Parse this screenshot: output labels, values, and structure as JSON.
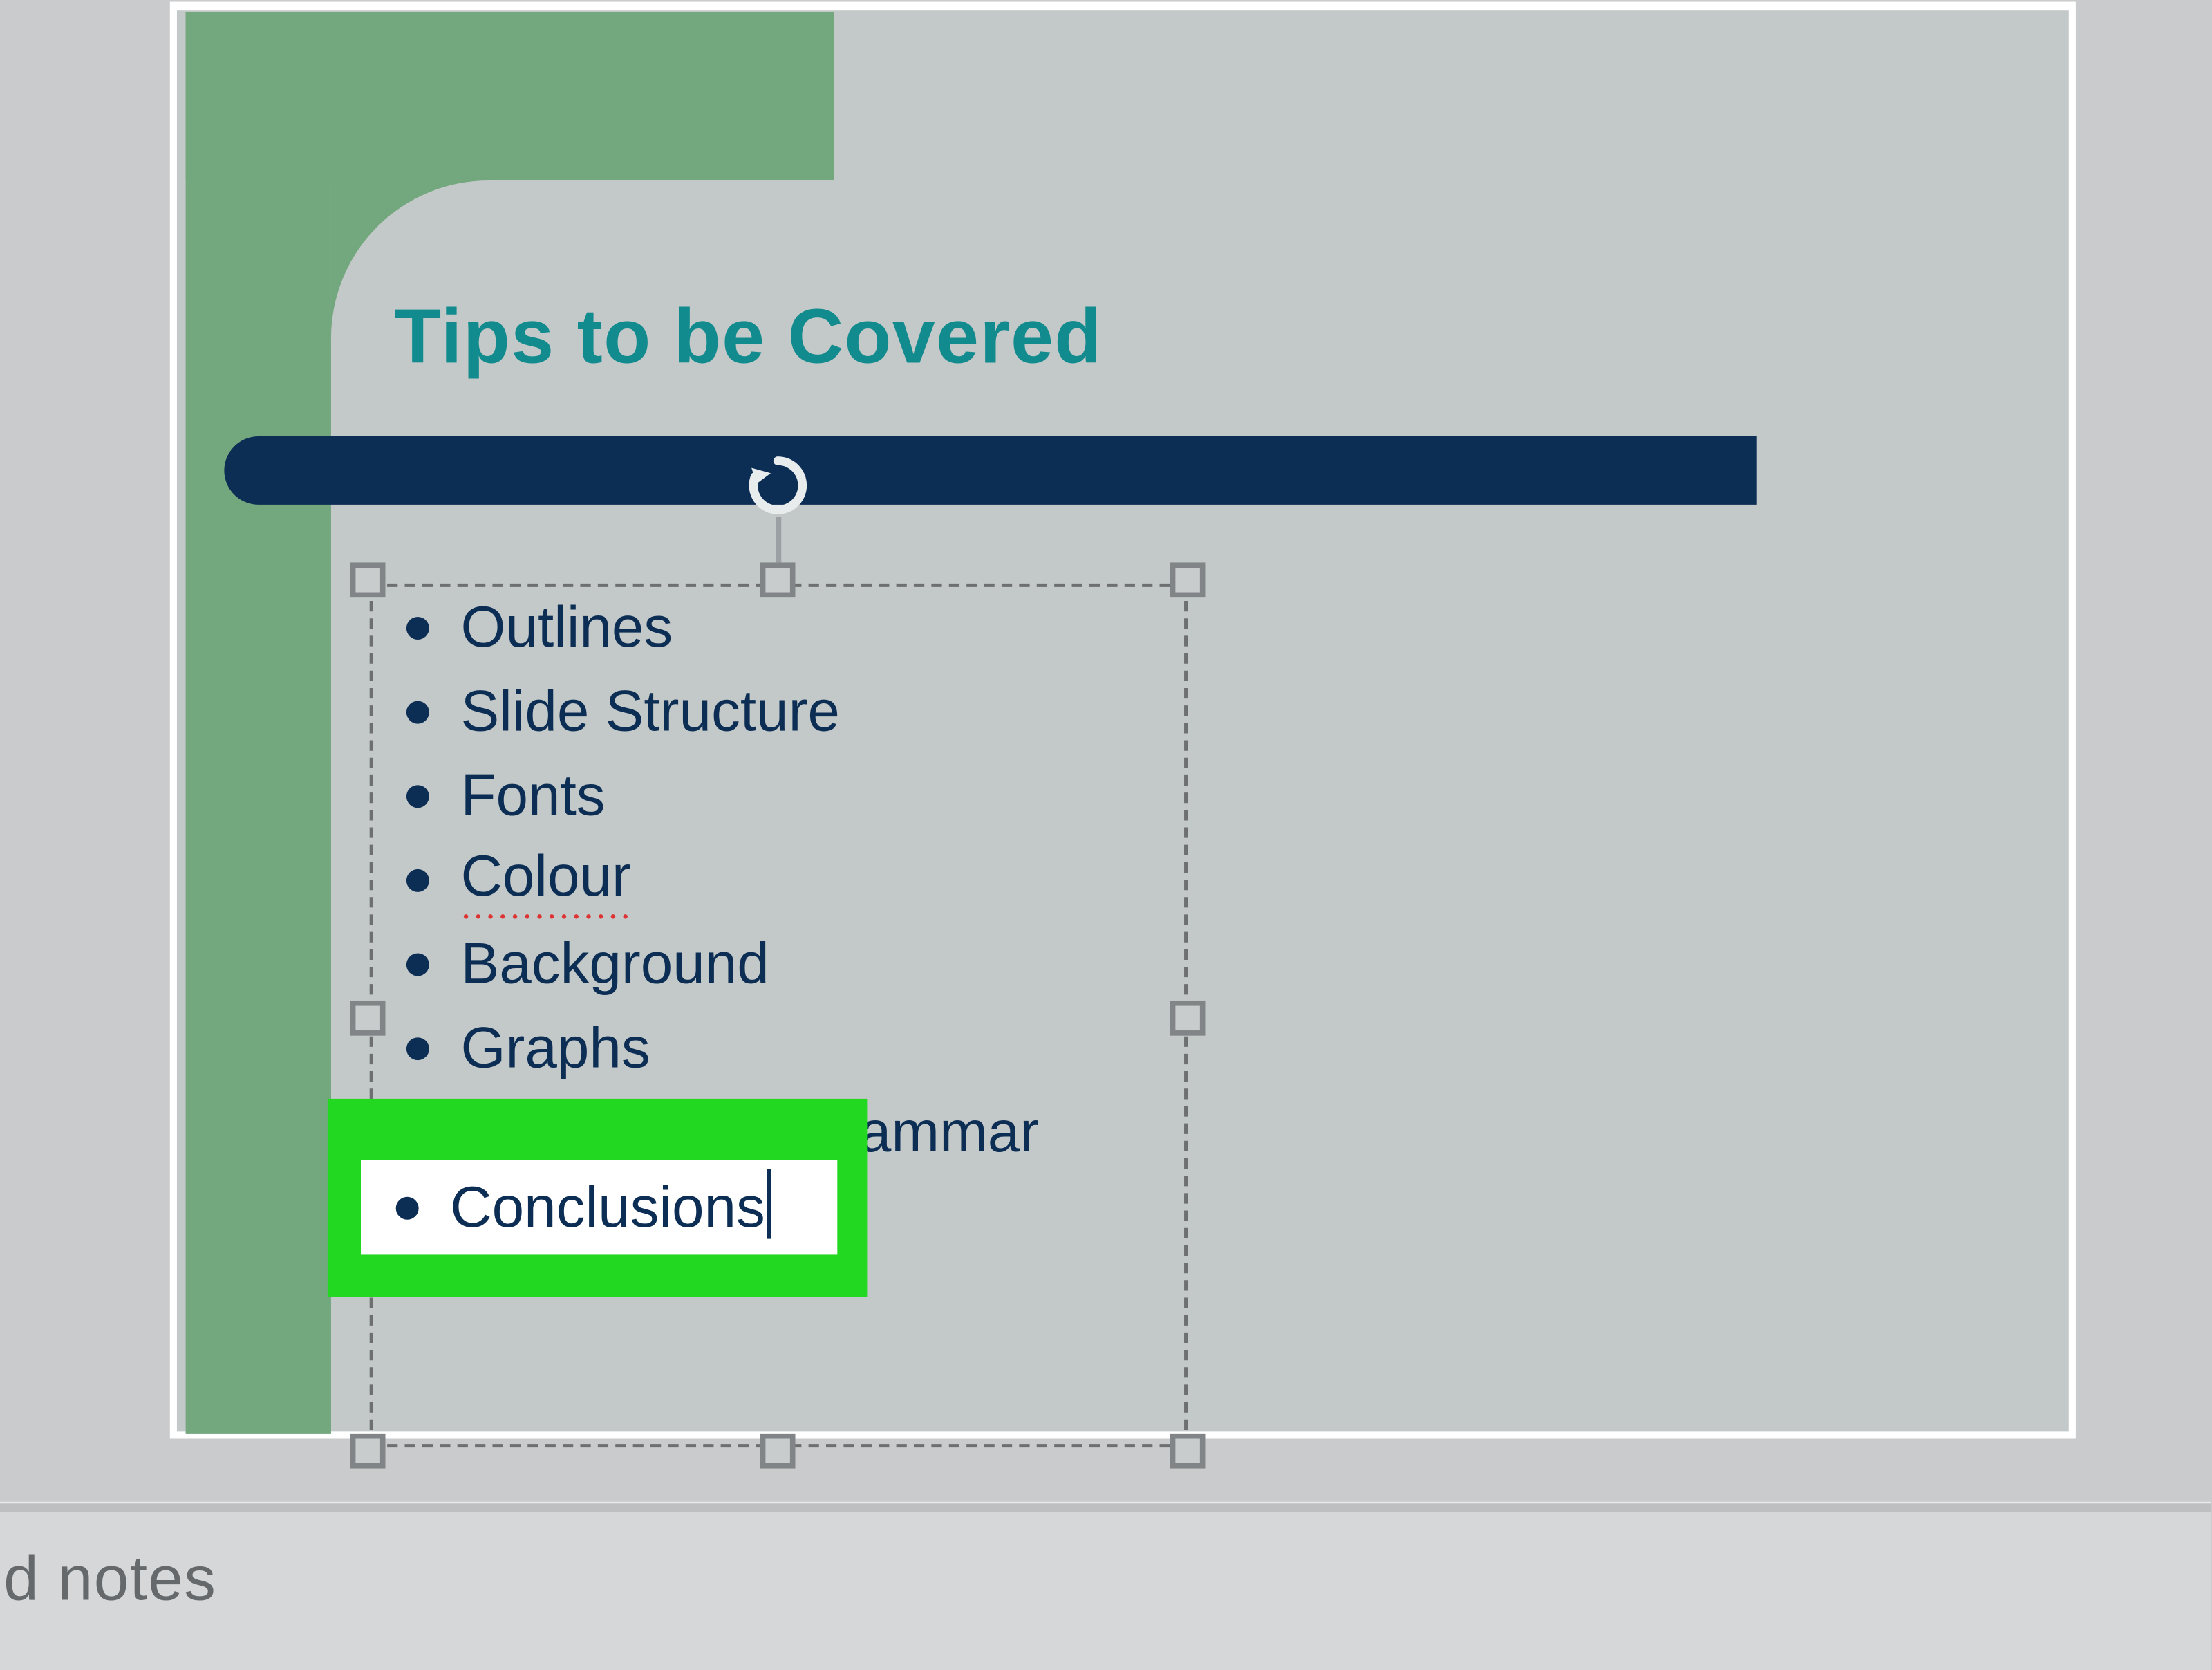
{
  "slide": {
    "title": "Tips to be Covered",
    "bullets": [
      "Outlines",
      "Slide Structure",
      "Fonts",
      "Colour",
      "Background",
      "Graphs",
      "Spelling and Grammar",
      "Conclusions"
    ],
    "spellcheck_flag_index": 3,
    "highlight_index": 7
  },
  "notes": {
    "placeholder_visible": "d notes"
  },
  "colors": {
    "app_bg": "#c9cbcc",
    "slide_bg": "#c3c9c8",
    "accent_green": "#73a77e",
    "title_teal": "#128b8e",
    "bar_navy": "#0c2d54",
    "text_navy": "#0c2d54",
    "highlight_green": "#22d821"
  }
}
